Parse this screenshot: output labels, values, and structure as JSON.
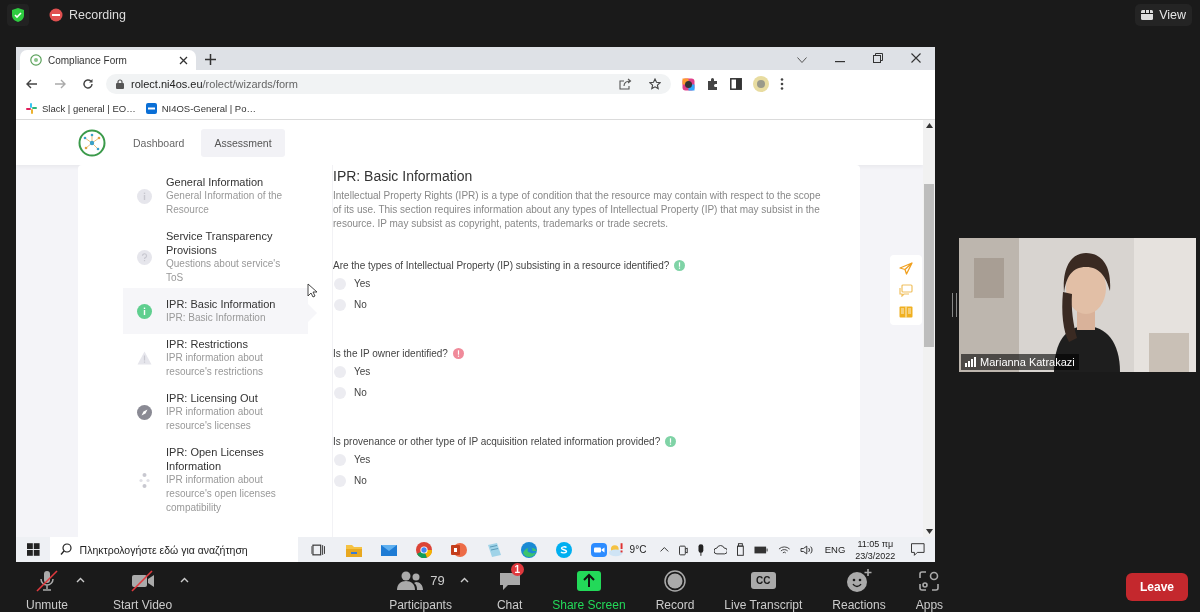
{
  "zoom_top_bar": {
    "recording_label": "Recording",
    "view_button": "View"
  },
  "browser": {
    "tab": {
      "title": "Compliance Form",
      "selected": true
    },
    "address": {
      "domain": "rolect.ni4os.eu",
      "path": "/rolect/wizards/form"
    },
    "bookmarks": [
      {
        "kind": "slack",
        "label": "Slack | general | EO…"
      },
      {
        "kind": "box",
        "label": "NI4OS-General | Po…"
      }
    ]
  },
  "app": {
    "nav": [
      {
        "label": "Dashboard",
        "selected": false
      },
      {
        "label": "Assessment",
        "selected": true
      }
    ],
    "steps": [
      {
        "kind": "info",
        "title": "General Information",
        "subtitle": "General Information of the Resource",
        "selected": false
      },
      {
        "kind": "question",
        "title": "Service Transparency Provisions",
        "subtitle": "Questions about service's ToS",
        "selected": false
      },
      {
        "kind": "info",
        "title": "IPR: Basic Information",
        "subtitle": "IPR: Basic Information",
        "selected": true
      },
      {
        "kind": "warning",
        "title": "IPR: Restrictions",
        "subtitle": "IPR information about resource's restrictions",
        "selected": false
      },
      {
        "kind": "compass",
        "title": "IPR: Licensing Out",
        "subtitle": "IPR information about resource's licenses",
        "selected": false
      },
      {
        "kind": "dots",
        "title": "IPR: Open Licenses Information",
        "subtitle": "IPR information about resource's open licenses compatibility",
        "selected": false
      }
    ],
    "form": {
      "title": "IPR: Basic Information",
      "description": "Intellectual Property Rights (IPR) is a type of condition that the resource may contain with respect to the scope of its use. This section requires information about any types of Intellectual Property (IP) that may subsist in the resource. IP may subsist as copyright, patents, trademarks or trade secrets.",
      "questions": [
        {
          "text": "Are the types of Intellectual Property (IP) subsisting in a resource identified?",
          "color": "#7fd3a6",
          "options": [
            {
              "label": "Yes",
              "selected": false
            },
            {
              "label": "No",
              "selected": false
            }
          ]
        },
        {
          "text": "Is the IP owner identified?",
          "color": "#f08a9a",
          "options": [
            {
              "label": "Yes",
              "selected": false
            },
            {
              "label": "No",
              "selected": false
            }
          ]
        },
        {
          "text": "Is provenance or other type of IP acquisition related information provided?",
          "color": "#7fd3a6",
          "options": [
            {
              "label": "Yes",
              "selected": false
            },
            {
              "label": "No",
              "selected": false
            }
          ]
        }
      ]
    },
    "side_tools": [
      {
        "kind": "send"
      },
      {
        "kind": "chat"
      },
      {
        "kind": "book"
      }
    ]
  },
  "taskbar": {
    "search_placeholder": "Πληκτρολογήστε εδώ για αναζήτηση",
    "apps": [
      {
        "kind": "folder"
      },
      {
        "kind": "mail"
      },
      {
        "kind": "chrome"
      },
      {
        "kind": "powerpoint"
      },
      {
        "kind": "notepad"
      },
      {
        "kind": "edge"
      },
      {
        "kind": "skype"
      },
      {
        "kind": "zoom"
      }
    ],
    "weather": "9°C",
    "language": "ENG",
    "time": "11:05 πμ",
    "date": "23/3/2022"
  },
  "video": {
    "participant_name": "Marianna Katrakazi"
  },
  "meeting_toolbar": {
    "items": [
      {
        "kind": "mic",
        "label": "Unmute",
        "has_menu": true
      },
      {
        "kind": "video",
        "label": "Start Video",
        "has_menu": true
      },
      {
        "kind": "participants",
        "label": "Participants",
        "count": "79",
        "has_menu": true
      },
      {
        "kind": "chat",
        "label": "Chat",
        "badge": "1",
        "has_menu": false
      },
      {
        "kind": "share",
        "label": "Share Screen",
        "has_menu": false
      },
      {
        "kind": "record",
        "label": "Record",
        "has_menu": false
      },
      {
        "kind": "cc",
        "label": "Live Transcript",
        "icon_text": "CC",
        "has_menu": false
      },
      {
        "kind": "reactions",
        "label": "Reactions",
        "has_menu": false
      },
      {
        "kind": "apps",
        "label": "Apps",
        "has_menu": false
      }
    ],
    "leave_button": "Leave"
  }
}
